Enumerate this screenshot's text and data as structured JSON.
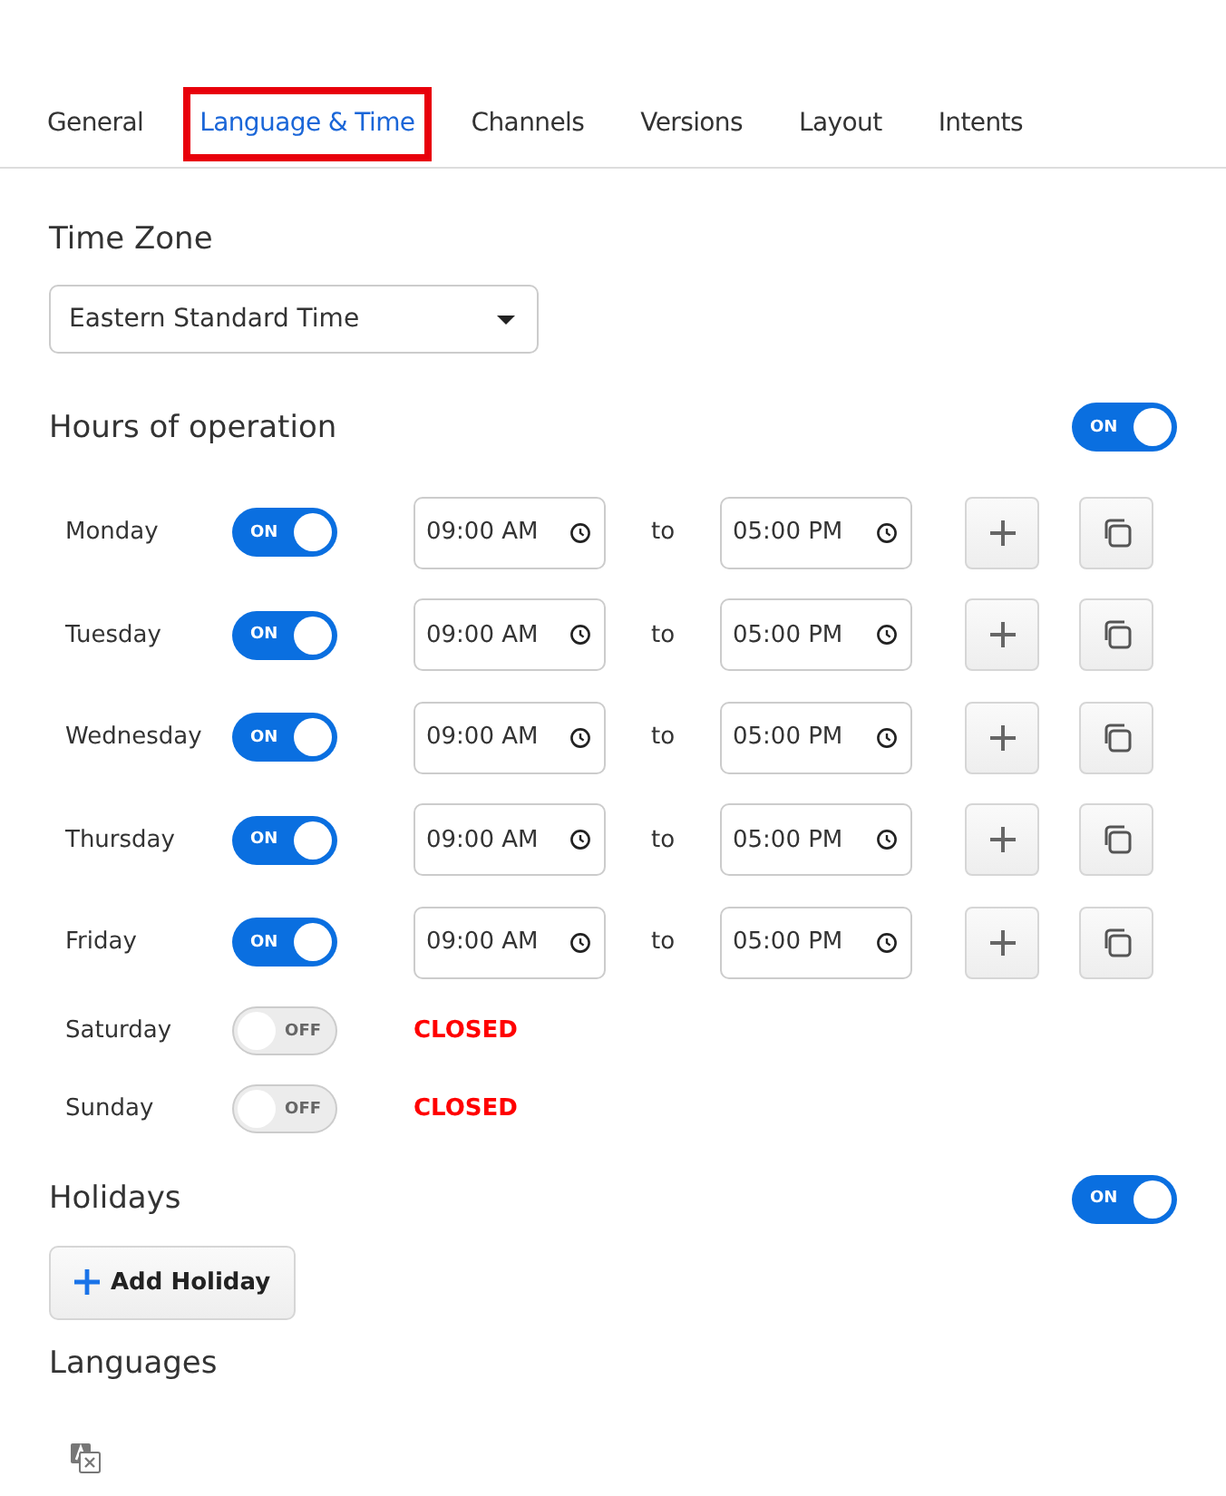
{
  "tabs": [
    {
      "label": "General",
      "selected": false,
      "highlighted": false
    },
    {
      "label": "Language & Time",
      "selected": true,
      "highlighted": true
    },
    {
      "label": "Channels",
      "selected": false,
      "highlighted": false
    },
    {
      "label": "Versions",
      "selected": false,
      "highlighted": false
    },
    {
      "label": "Layout",
      "selected": false,
      "highlighted": false
    },
    {
      "label": "Intents",
      "selected": false,
      "highlighted": false
    }
  ],
  "time_zone": {
    "heading": "Time Zone",
    "value": "Eastern Standard Time"
  },
  "hours": {
    "heading": "Hours of operation",
    "on": true,
    "toggle_text": "ON",
    "days": [
      {
        "name": "Monday",
        "on": true,
        "toggle_text": "ON",
        "open": "09:00 AM",
        "separator": "to",
        "close": "05:00 PM"
      },
      {
        "name": "Tuesday",
        "on": true,
        "toggle_text": "ON",
        "open": "09:00 AM",
        "separator": "to",
        "close": "05:00 PM"
      },
      {
        "name": "Wednesday",
        "on": true,
        "toggle_text": "ON",
        "open": "09:00 AM",
        "separator": "to",
        "close": "05:00 PM"
      },
      {
        "name": "Thursday",
        "on": true,
        "toggle_text": "ON",
        "open": "09:00 AM",
        "separator": "to",
        "close": "05:00 PM"
      },
      {
        "name": "Friday",
        "on": true,
        "toggle_text": "ON",
        "open": "09:00 AM",
        "separator": "to",
        "close": "05:00 PM"
      },
      {
        "name": "Saturday",
        "on": false,
        "toggle_text": "OFF",
        "status": "CLOSED"
      },
      {
        "name": "Sunday",
        "on": false,
        "toggle_text": "OFF",
        "status": "CLOSED"
      }
    ]
  },
  "holidays": {
    "heading": "Holidays",
    "on": true,
    "toggle_text": "ON",
    "add_button": "Add Holiday"
  },
  "languages": {
    "heading": "Languages"
  }
}
